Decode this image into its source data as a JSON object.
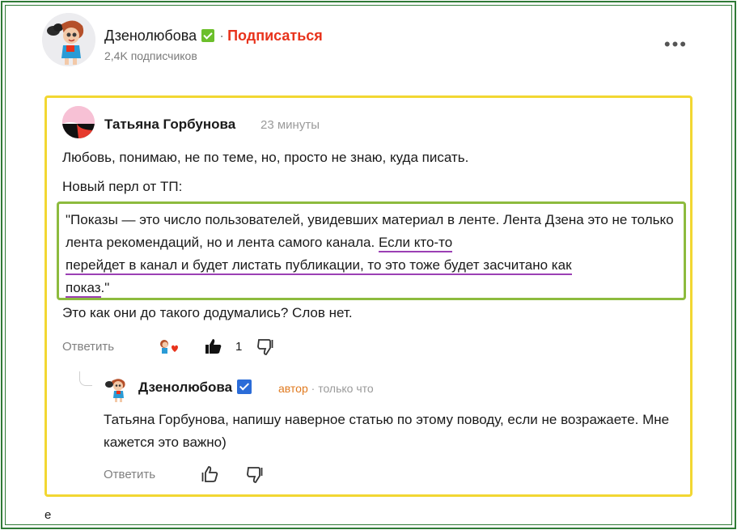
{
  "channel": {
    "name": "Дзенолюбова",
    "separator": "·",
    "subscribe_label": "Подписаться",
    "subscribers": "2,4K подписчиков",
    "more_icon": "•••",
    "verified_color": "#6cbf2b",
    "subscribe_color": "#e8331c"
  },
  "comment": {
    "author": "Татьяна Горбунова",
    "time": "23 минуты",
    "line1": "Любовь, понимаю, не по теме, но, просто не знаю, куда писать.",
    "line2": "Новый перл от ТП:",
    "quote": {
      "part1": "\"Показы — это число пользователей, увидевших материал в ленте. Лента Дзена это не только лента рекомендаций, но и лента самого канала. ",
      "underlined1": "Если кто-то",
      "underlined2": "перейдет в канал и будет листать публикации, то это тоже будет засчитано как",
      "underlined3": "показ",
      "part2": ".\""
    },
    "line3": "Это как они до такого додумались? Слов нет.",
    "reply_label": "Ответить",
    "like_count": "1",
    "highlight_border_color": "#f2d732",
    "quote_border_color": "#8dbb3e",
    "underline_color": "#9b3fb4"
  },
  "reply": {
    "author": "Дзенолюбова",
    "author_badge": "автор",
    "separator": "·",
    "time": "только что",
    "text": "Татьяна Горбунова, напишу наверное статью по этому поводу, если не возражаете. Мне кажется это важно)",
    "reply_label": "Ответить",
    "verified_color": "#2b6cd8"
  },
  "footer": {
    "stray_char": "e"
  }
}
